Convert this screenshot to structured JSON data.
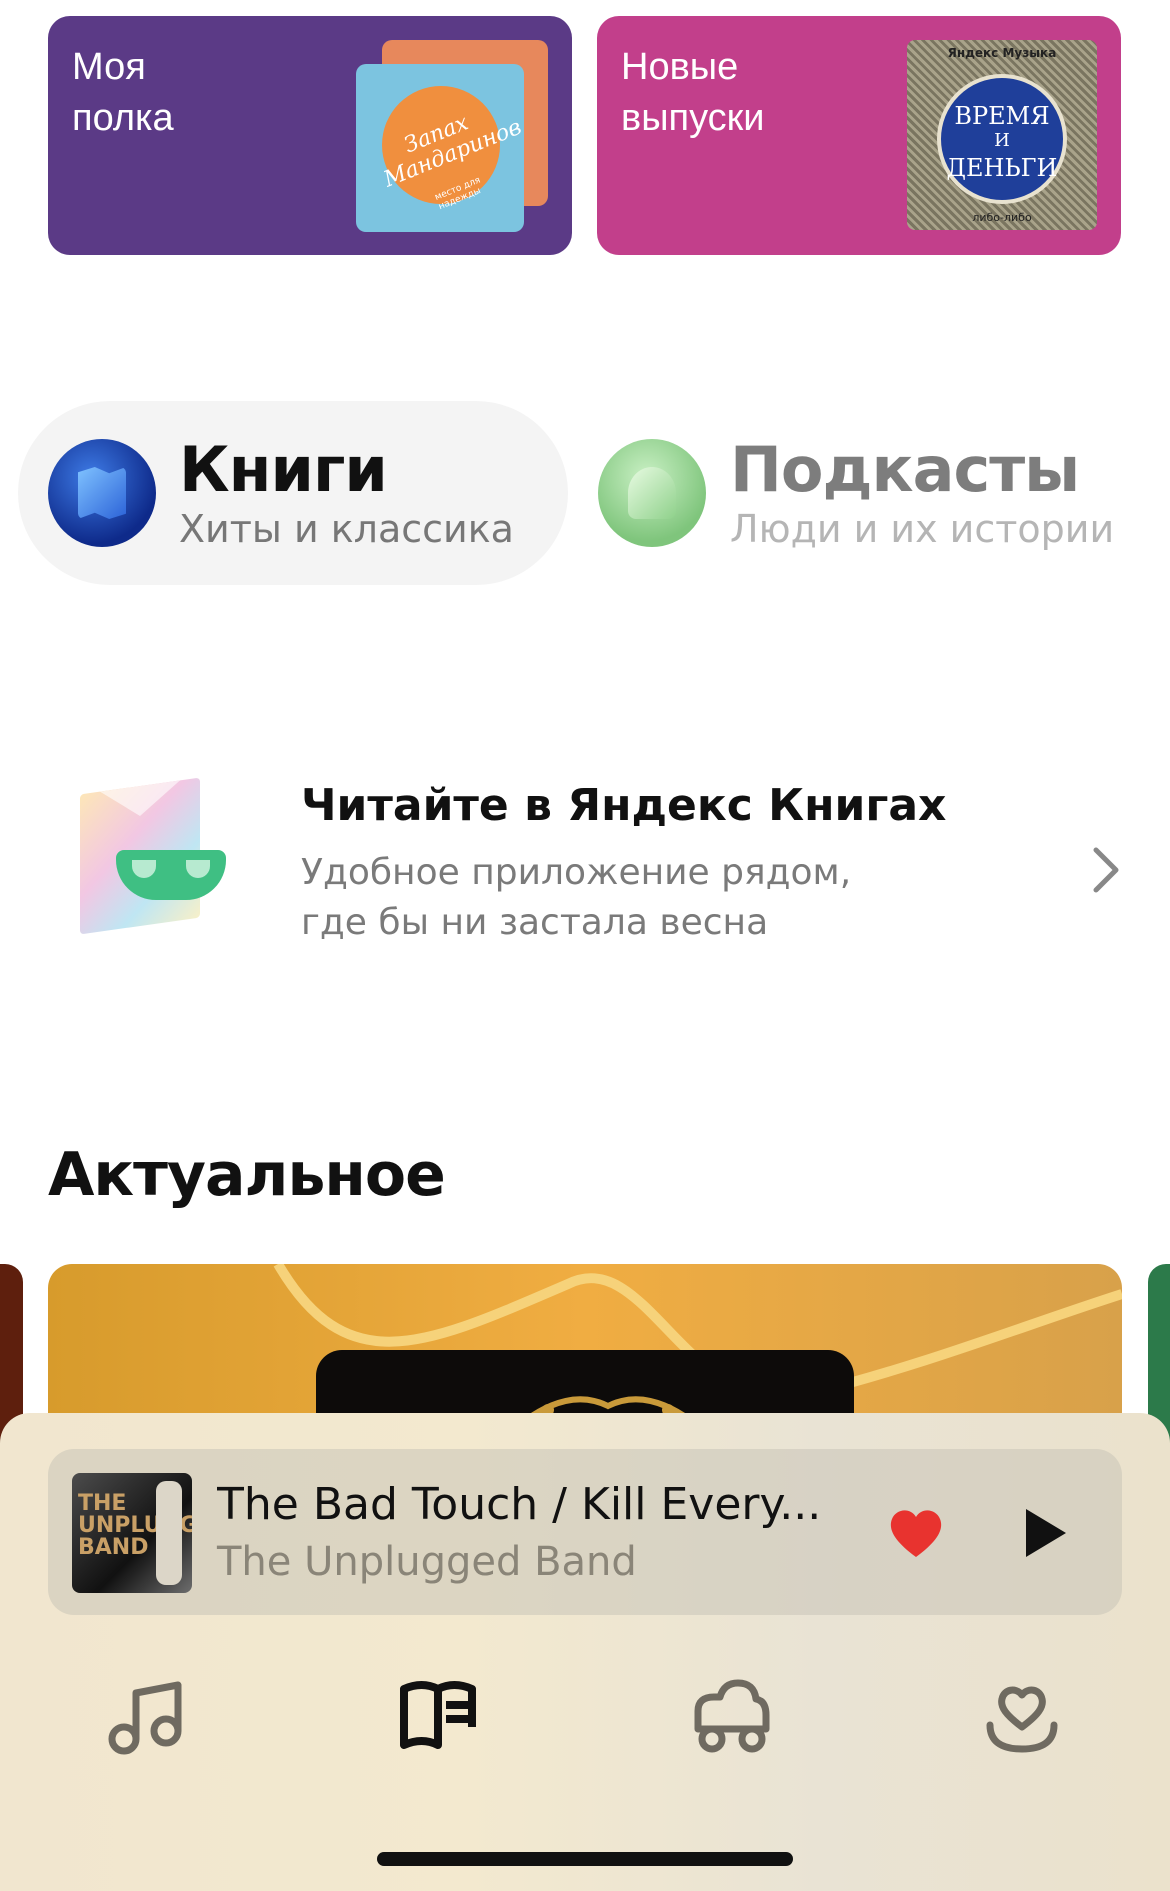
{
  "top_cards": {
    "shelf": {
      "title": "Моя\nполка",
      "cover_text": "Запах\nМандаринов",
      "cover_sub": "место для надежды"
    },
    "new_releases": {
      "title": "Новые\nвыпуски",
      "cover_brand": "Яндекс Музыка",
      "cover_line1": "ВРЕМЯ",
      "cover_line2": "И",
      "cover_line3": "ДЕНЬГИ",
      "cover_foot": "либо-либо"
    }
  },
  "tabs": {
    "books": {
      "title": "Книги",
      "subtitle": "Хиты и классика",
      "selected": true
    },
    "podcasts": {
      "title": "Подкасты",
      "subtitle": "Люди и их истории",
      "selected": false
    }
  },
  "banner": {
    "title": "Читайте в Яндекс Книгах",
    "subtitle": "Удобное приложение рядом,\nгде бы ни застала весна"
  },
  "section": {
    "title": "Актуальное"
  },
  "player": {
    "track_title": "The Bad Touch / Kill Every...",
    "artist": "The Unplugged Band",
    "cover_text": "THE UNPLUGGED BAND",
    "liked": true,
    "heart_color": "#e8332f"
  },
  "nav": {
    "items": [
      {
        "icon": "music-note-icon",
        "selected": false
      },
      {
        "icon": "book-icon",
        "selected": true
      },
      {
        "icon": "kids-car-icon",
        "selected": false
      },
      {
        "icon": "heart-collection-icon",
        "selected": false
      }
    ]
  },
  "colors": {
    "shelf_card": "#5b3a86",
    "new_card": "#c23f8b",
    "feature_banner": "#f0ad42",
    "bottom_bar": "#f1e6cf"
  }
}
